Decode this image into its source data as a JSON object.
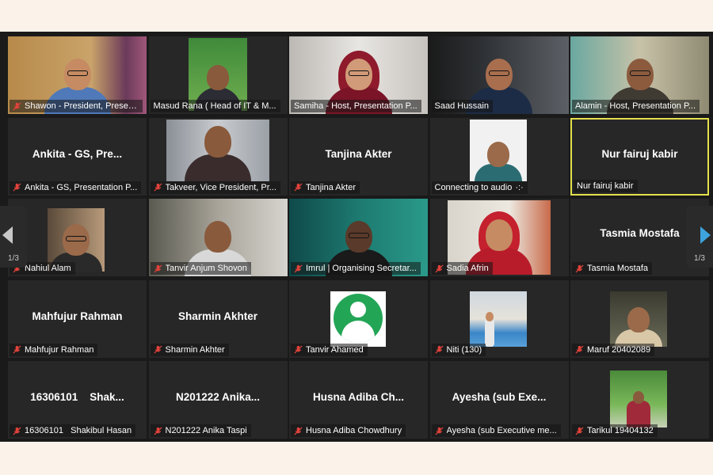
{
  "pagination": {
    "left_page": "1/3",
    "right_page": "1/3"
  },
  "colors": {
    "tile_bg": "#272727",
    "active_border": "#e4e04c",
    "muted_mic": "#e0423a",
    "next_arrow": "#3da3dd"
  },
  "tiles": [
    {
      "label": "Shawon - President, Presentation P...",
      "big": "",
      "muted": true
    },
    {
      "label": "Masud Rana ( Head of IT & M...",
      "big": "",
      "muted": false
    },
    {
      "label": "Samiha - Host, Presentation P...",
      "big": "",
      "muted": false
    },
    {
      "label": "Saad Hussain",
      "big": "",
      "muted": false
    },
    {
      "label": "Alamin - Host, Presentation P...",
      "big": "",
      "muted": false
    },
    {
      "label": "Ankita - GS, Presentation P...",
      "big": "Ankita - GS, Pre...",
      "muted": true
    },
    {
      "label": "Takveer, Vice President, Pr...",
      "big": "",
      "muted": true
    },
    {
      "label": "Tanjina Akter",
      "big": "Tanjina Akter",
      "muted": true
    },
    {
      "label": "Connecting to audio",
      "big": "",
      "muted": false
    },
    {
      "label": "Nur fairuj kabir",
      "big": "Nur fairuj kabir",
      "muted": false,
      "active": true
    },
    {
      "label": "Nahiul Alam",
      "big": "",
      "muted": true
    },
    {
      "label": "Tanvir Anjum Shovon",
      "big": "",
      "muted": true
    },
    {
      "label": "Imrul | Organising Secretar...",
      "big": "",
      "muted": true
    },
    {
      "label": "Sadia Afrin",
      "big": "",
      "muted": true
    },
    {
      "label": "Tasmia Mostafa",
      "big": "Tasmia Mostafa",
      "muted": true
    },
    {
      "label": "Mahfujur Rahman",
      "big": "Mahfujur Rahman",
      "muted": true
    },
    {
      "label": "Sharmin Akhter",
      "big": "Sharmin Akhter",
      "muted": true
    },
    {
      "label": "Tanvir Ahamed",
      "big": "",
      "muted": true
    },
    {
      "label": "Niti (130)",
      "big": "",
      "muted": true
    },
    {
      "label": "Maruf 20402089",
      "big": "",
      "muted": true
    },
    {
      "label": "16306101   Shakibul Hasan",
      "big": "16306101    Shak...",
      "muted": true
    },
    {
      "label": "N201222 Anika Taspi",
      "big": "N201222 Anika...",
      "muted": true
    },
    {
      "label": "Husna Adiba Chowdhury",
      "big": "Husna Adiba Ch...",
      "muted": true
    },
    {
      "label": "Ayesha (sub Executive me...",
      "big": "Ayesha (sub Exe...",
      "muted": true
    },
    {
      "label": "Tarikul 19404132",
      "big": "",
      "muted": true
    }
  ]
}
